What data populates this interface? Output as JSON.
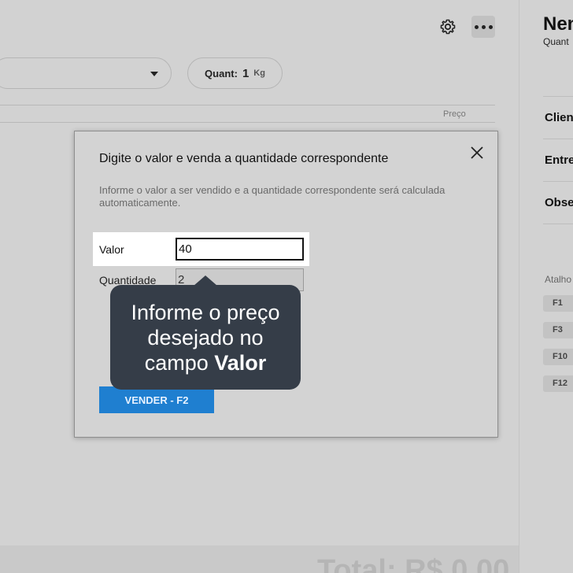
{
  "toolbar": {
    "settings_icon": "gear-icon",
    "more_icon": "more-horizontal-icon"
  },
  "product_select": {
    "caret_icon": "caret-down-icon"
  },
  "quantity_pill": {
    "label": "Quant:",
    "value": "1",
    "unit": "Kg"
  },
  "table": {
    "price_header": "Preço"
  },
  "footer": {
    "total": "Total: R$ 0,00"
  },
  "sidebar": {
    "title": "Nen",
    "subtitle": "Quant",
    "rows": [
      "Clien",
      "Entre",
      "Obse"
    ],
    "shortcuts_label": "Atalho",
    "keys": [
      "F1",
      "F3",
      "F10",
      "F12"
    ]
  },
  "modal": {
    "title": "Digite o valor e venda a quantidade correspondente",
    "description": "Informe o valor a ser vendido e a quantidade correspondente será calculada automaticamente.",
    "value_label": "Valor",
    "value_input": "40",
    "quantity_label": "Quantidade",
    "quantity_input": "2",
    "sell_button": "VENDER - F2",
    "close_icon": "close-icon"
  },
  "tooltip": {
    "line1": "Informe o preço",
    "line2": "desejado no",
    "line3_prefix": "campo ",
    "line3_bold": "Valor"
  },
  "colors": {
    "primary": "#1f7fd0",
    "tooltip_bg": "#353d48",
    "overlay": "#d0d0d0"
  }
}
